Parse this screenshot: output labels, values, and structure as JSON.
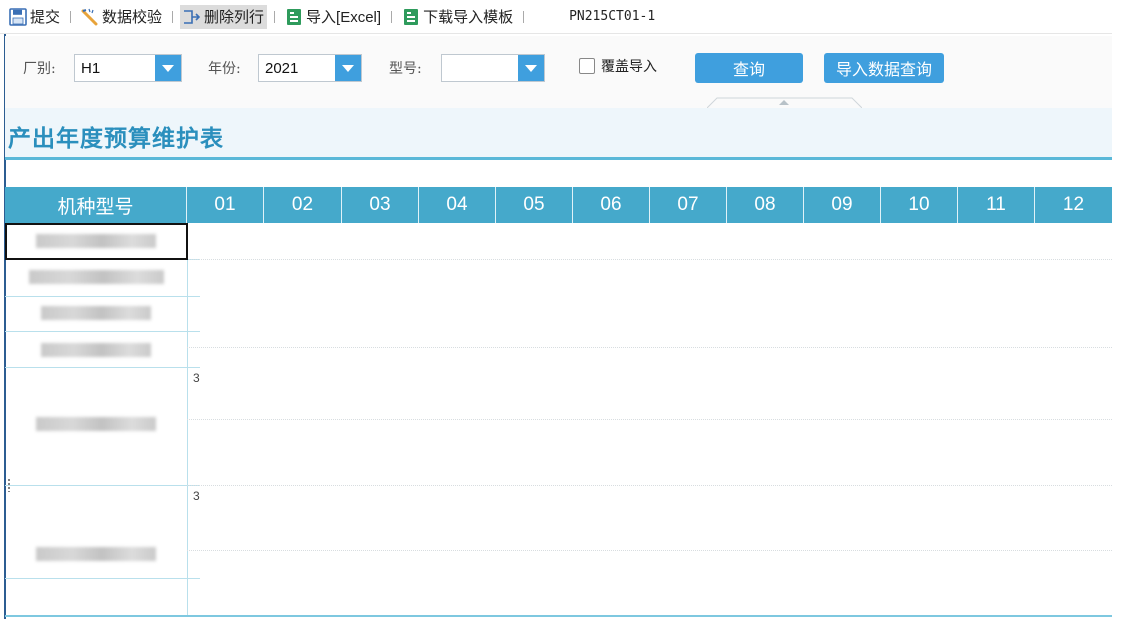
{
  "toolbar": {
    "submit_label": "提交",
    "validate_label": "数据校验",
    "delete_row_label": "删除列行",
    "import_excel_label": "导入[Excel]",
    "download_template_label": "下载导入模板",
    "page_code": "PN215CT01-1"
  },
  "filters": {
    "factory_label": "厂别:",
    "factory_value": "H1",
    "year_label": "年份:",
    "year_value": "2021",
    "model_label": "型号:",
    "model_value": "",
    "overwrite_label": "覆盖导入",
    "overwrite_checked": false,
    "query_label": "查询",
    "import_query_label": "导入数据查询"
  },
  "page": {
    "title": "产出年度预算维护表"
  },
  "grid": {
    "columns": [
      "机种型号",
      "01",
      "02",
      "03",
      "04",
      "05",
      "06",
      "07",
      "08",
      "09",
      "10",
      "11",
      "12"
    ],
    "row_marks": [
      "3",
      "3"
    ]
  },
  "colors": {
    "accent": "#3f9fde",
    "header_bg": "#45a9cb",
    "title_color": "#2b8fbd"
  },
  "icons": [
    "save-icon",
    "validate-icon",
    "delete-row-icon",
    "excel-icon",
    "excel-icon"
  ]
}
